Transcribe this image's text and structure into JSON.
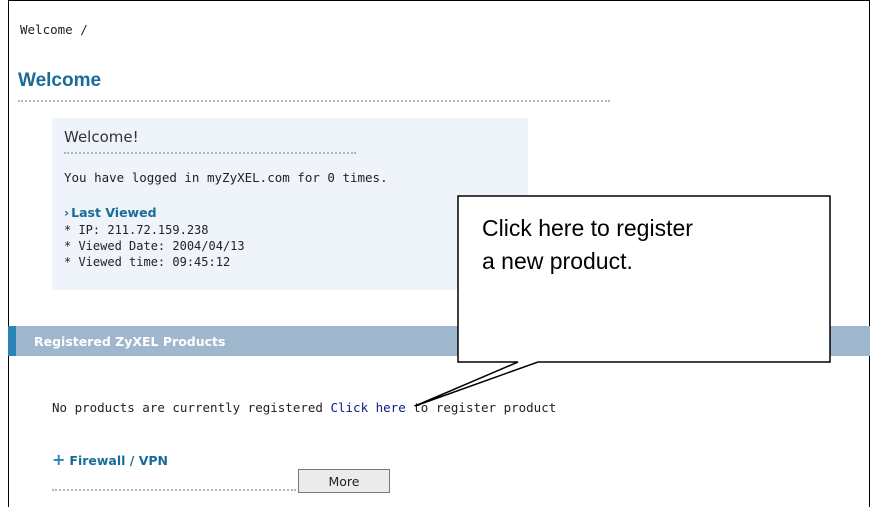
{
  "breadcrumb": "Welcome /",
  "page_title": "Welcome",
  "welcome": {
    "heading": "Welcome!",
    "logged_text": "You have logged in myZyXEL.com for 0 times.",
    "last_viewed_label": "Last Viewed",
    "ip": "* IP: 211.72.159.238",
    "viewed_date": "* Viewed Date: 2004/04/13",
    "viewed_time": "* Viewed time: 09:45:12"
  },
  "registered_section": {
    "title": "Registered ZyXEL Products",
    "no_products_prefix": "No products are currently registered",
    "click_here": "Click here",
    "no_products_suffix": "to register product"
  },
  "firewall": {
    "label": "Firewall / VPN",
    "more_button": "More"
  },
  "callout": {
    "line1": "Click here to register",
    "line2": "a new product."
  },
  "colors": {
    "title_blue": "#1a6b99",
    "section_bar": "#9fb7cc",
    "section_accent": "#2a84b8",
    "link_blue": "#0b1a8a",
    "box_bg": "#eef4fa"
  }
}
